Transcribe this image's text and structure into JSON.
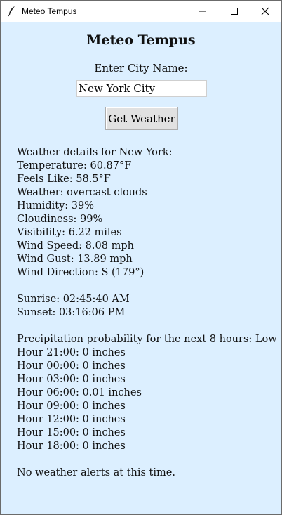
{
  "window": {
    "title": "Meteo Tempus",
    "icon": "feather-icon"
  },
  "app": {
    "title": "Meteo Tempus",
    "city_label": "Enter City Name:",
    "city_input_value": "New York City",
    "get_weather_label": "Get Weather"
  },
  "weather": {
    "header": "Weather details for New York:",
    "temperature": "Temperature: 60.87°F",
    "feels_like": "Feels Like: 58.5°F",
    "condition": "Weather: overcast clouds",
    "humidity": "Humidity: 39%",
    "cloudiness": "Cloudiness: 99%",
    "visibility": "Visibility: 6.22 miles",
    "wind_speed": "Wind Speed: 8.08 mph",
    "wind_gust": "Wind Gust: 13.89 mph",
    "wind_direction": "Wind Direction: S (179°)",
    "sunrise": "Sunrise: 02:45:40 AM",
    "sunset": "Sunset: 03:16:06 PM",
    "precip_header": "Precipitation probability for the next 8 hours: Low",
    "hours": [
      "Hour 21:00: 0 inches",
      "Hour 00:00: 0 inches",
      "Hour 03:00: 0 inches",
      "Hour 06:00: 0.01 inches",
      "Hour 09:00: 0 inches",
      "Hour 12:00: 0 inches",
      "Hour 15:00: 0 inches",
      "Hour 18:00: 0 inches"
    ],
    "alerts": "No weather alerts at this time."
  },
  "colors": {
    "background": "#dcefff",
    "titlebar": "#ffffff",
    "button_face": "#e1e1e1"
  }
}
